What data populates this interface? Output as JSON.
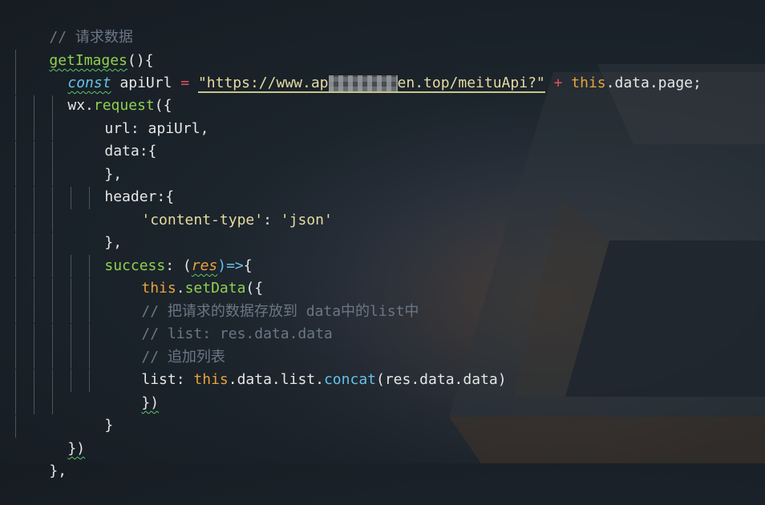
{
  "code": {
    "comment_request": "// 请求数据",
    "fn_name": "getImages",
    "fn_paren": "(){",
    "const_kw": "const",
    "var_api": "apiUrl",
    "eq": "=",
    "url_pre": "\"https://www.ap",
    "url_post": "en.top/meituApi?\"",
    "plus": "+",
    "this_kw": "this",
    "data_page": ".data.page;",
    "wx": "wx.",
    "request": "request",
    "request_open": "({",
    "url_key": "url: apiUrl,",
    "data_key": "data:{",
    "close_brace_comma": "},",
    "header_key": "header:{",
    "ct_key": "'content-type'",
    "ct_colon": ": ",
    "ct_val": "'json'",
    "success_key": "success",
    "success_colon": ": (",
    "res": "res",
    "arrow": ")=>",
    "open_brace": "{",
    "setData": "setData",
    "setData_open": "({",
    "dot": ".",
    "comment_save": "// 把请求的数据存放到 data中的list中",
    "comment_list": "// list: res.data.data",
    "comment_append": "// 追加列表",
    "list_key": "list: ",
    "data_list": ".data.list.",
    "concat": "concat",
    "concat_args": "(res.data.data)",
    "close_paren_brace": "})",
    "close_brace": "}"
  },
  "colors": {
    "comment": "#6b7785",
    "function": "#8fd14f",
    "keyword": "#66c2e8",
    "this": "#e8a33d",
    "string": "#e6dba0",
    "operator": "#e8505b"
  }
}
